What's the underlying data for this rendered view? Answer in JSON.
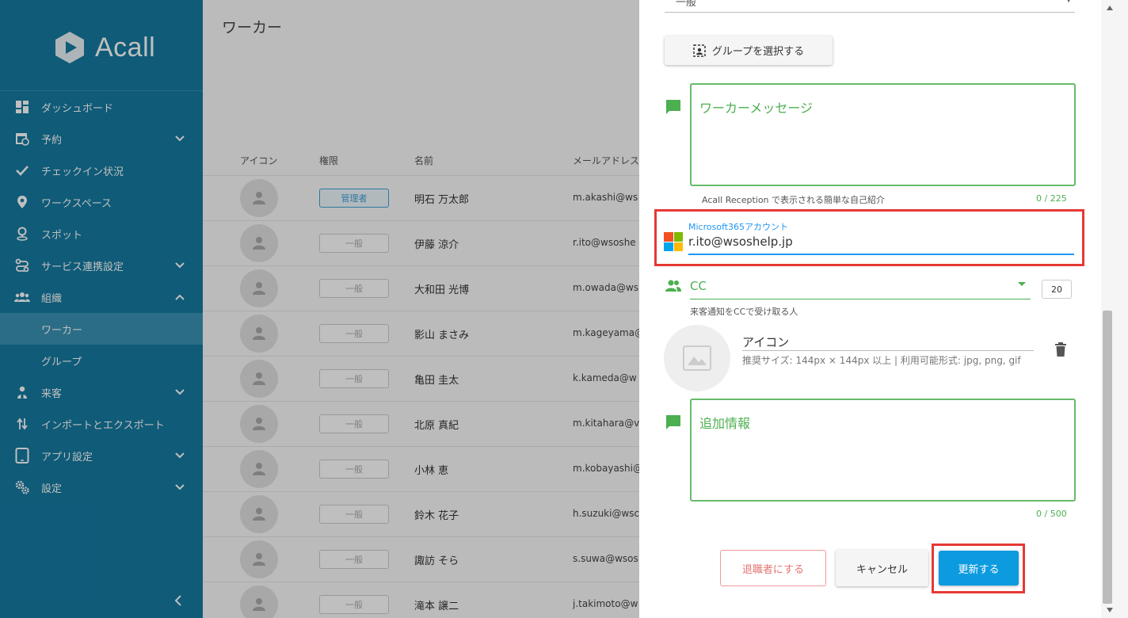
{
  "app": {
    "name": "Acall"
  },
  "sidebar": {
    "items": [
      {
        "label": "ダッシュボード",
        "icon": "dashboard-icon"
      },
      {
        "label": "予約",
        "icon": "calendar-icon",
        "expandable": true
      },
      {
        "label": "チェックイン状況",
        "icon": "check-icon"
      },
      {
        "label": "ワークスペース",
        "icon": "map-pin-icon"
      },
      {
        "label": "スポット",
        "icon": "spot-pin-icon"
      },
      {
        "label": "サービス連携設定",
        "icon": "link-icon",
        "expandable": true
      },
      {
        "label": "組織",
        "icon": "people-icon",
        "expanded": true
      },
      {
        "label": "ワーカー",
        "sub": true,
        "active": true
      },
      {
        "label": "グループ",
        "sub": true
      },
      {
        "label": "来客",
        "icon": "visitor-icon",
        "expandable": true
      },
      {
        "label": "インポートとエクスポート",
        "icon": "import-export-icon"
      },
      {
        "label": "アプリ設定",
        "icon": "tablet-icon",
        "expandable": true
      },
      {
        "label": "設定",
        "icon": "settings-icon",
        "expandable": true
      }
    ]
  },
  "main": {
    "title": "ワーカー",
    "columns": [
      "アイコン",
      "権限",
      "名前",
      "メールアドレス"
    ],
    "rows": [
      {
        "role": "管理者",
        "admin": true,
        "name": "明石 万太郎",
        "email": "m.akashi@ws"
      },
      {
        "role": "一般",
        "name": "伊藤 涼介",
        "email": "r.ito@wsoshe"
      },
      {
        "role": "一般",
        "name": "大和田 光博",
        "email": "m.owada@ws"
      },
      {
        "role": "一般",
        "name": "影山 まさみ",
        "email": "m.kageyama@"
      },
      {
        "role": "一般",
        "name": "亀田 圭太",
        "email": "k.kameda@w"
      },
      {
        "role": "一般",
        "name": "北原 真紀",
        "email": "m.kitahara@v"
      },
      {
        "role": "一般",
        "name": "小林 恵",
        "email": "m.kobayashi@"
      },
      {
        "role": "一般",
        "name": "鈴木 花子",
        "email": "h.suzuki@wsc"
      },
      {
        "role": "一般",
        "name": "諏訪 そら",
        "email": "s.suwa@wsos"
      },
      {
        "role": "一般",
        "name": "滝本 譲二",
        "email": "j.takimoto@w"
      }
    ]
  },
  "panel": {
    "top_select_value": "一般",
    "group_button": "グループを選択する",
    "message": {
      "placeholder": "ワーカーメッセージ",
      "hint": "Acall Reception で表示される簡単な自己紹介",
      "counter": "0 / 225"
    },
    "ms365": {
      "label": "Microsoft365アカウント",
      "value": "r.ito@wsoshelp.jp"
    },
    "cc": {
      "label": "CC",
      "number": "20",
      "hint": "来客通知をCCで受け取る人"
    },
    "icon": {
      "title": "アイコン",
      "hint": "推奨サイズ: 144px × 144px 以上 | 利用可能形式: jpg, png, gif"
    },
    "extra": {
      "placeholder": "追加情報",
      "counter": "0 / 500"
    },
    "buttons": {
      "retire": "退職者にする",
      "cancel": "キャンセル",
      "update": "更新する"
    }
  },
  "colors": {
    "sidebar": "#157aa1",
    "accent_green": "#4caf50",
    "primary_blue": "#0d9be0",
    "highlight_red": "#e53935"
  }
}
